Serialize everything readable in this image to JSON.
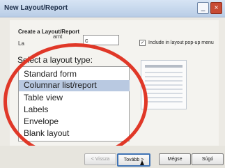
{
  "window": {
    "title": "New Layout/Report",
    "buttons": {
      "minimize": "_",
      "close": "×"
    }
  },
  "form": {
    "create_label": "Create a Layout/Report",
    "name_short_label": "La",
    "name_input_value": "c",
    "name_prefix_text": "amt",
    "include_in_popup_checked": true,
    "include_in_popup_label": "Include in layout pop-up menu"
  },
  "select_label": "Select a layout type:",
  "layout_types": [
    {
      "label": "Standard form",
      "selected": false
    },
    {
      "label": "Columnar list/report",
      "selected": true
    },
    {
      "label": "Table view",
      "selected": false
    },
    {
      "label": "Labels",
      "selected": false
    },
    {
      "label": "Envelope",
      "selected": false
    },
    {
      "label": "Blank layout",
      "selected": false
    }
  ],
  "footer": {
    "back_label": "< Vissza",
    "next_label": "Tovább >",
    "cancel_label": "Mégse",
    "help_label": "Súgó"
  },
  "icons": {
    "preview": "layout-preview-icon",
    "cursor": "cursor-icon",
    "check": "check-icon"
  },
  "colors": {
    "highlight_circle": "#e03828",
    "selection": "#b9c9e1",
    "titlebar": "#b9cde6"
  }
}
